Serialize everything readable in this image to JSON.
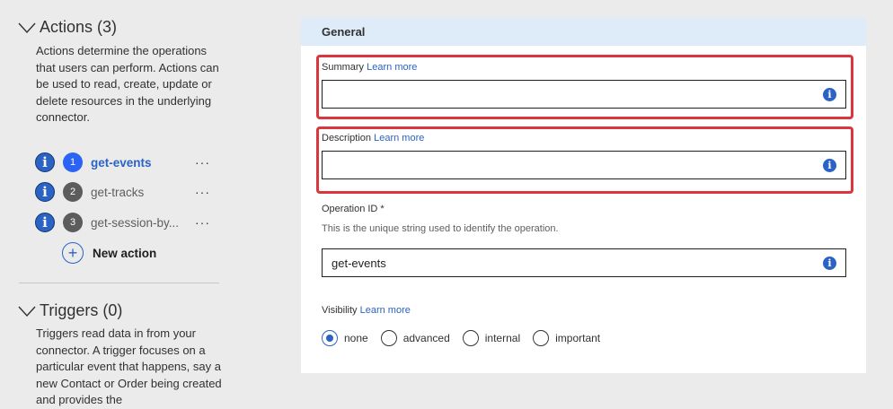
{
  "actions_section": {
    "title": "Actions (3)",
    "description": "Actions determine the operations that users can perform. Actions can be used to read, create, update or delete resources in the underlying connector.",
    "items": [
      {
        "number": "1",
        "label": "get-events",
        "active": true
      },
      {
        "number": "2",
        "label": "get-tracks",
        "active": false
      },
      {
        "number": "3",
        "label": "get-session-by...",
        "active": false
      }
    ],
    "more_label": "···",
    "new_action_label": "New action"
  },
  "triggers_section": {
    "title": "Triggers (0)",
    "description": "Triggers read data in from your connector. A trigger focuses on a particular event that happens, say a new Contact or Order being created and provides the"
  },
  "general": {
    "header": "General",
    "summary": {
      "label": "Summary",
      "learn_more": "Learn more",
      "value": ""
    },
    "description": {
      "label": "Description",
      "learn_more": "Learn more",
      "value": ""
    },
    "operation_id": {
      "label": "Operation ID *",
      "helper": "This is the unique string used to identify the operation.",
      "value": "get-events"
    },
    "visibility": {
      "label": "Visibility",
      "learn_more": "Learn more",
      "options": [
        "none",
        "advanced",
        "internal",
        "important"
      ],
      "selected": "none"
    }
  },
  "colors": {
    "accent": "#2b63c4",
    "highlight": "#d9363e",
    "header_bg": "#deecf9"
  },
  "icons": {
    "info": "info-icon",
    "expand": "chevron-down-icon",
    "add": "plus-circle-icon"
  }
}
